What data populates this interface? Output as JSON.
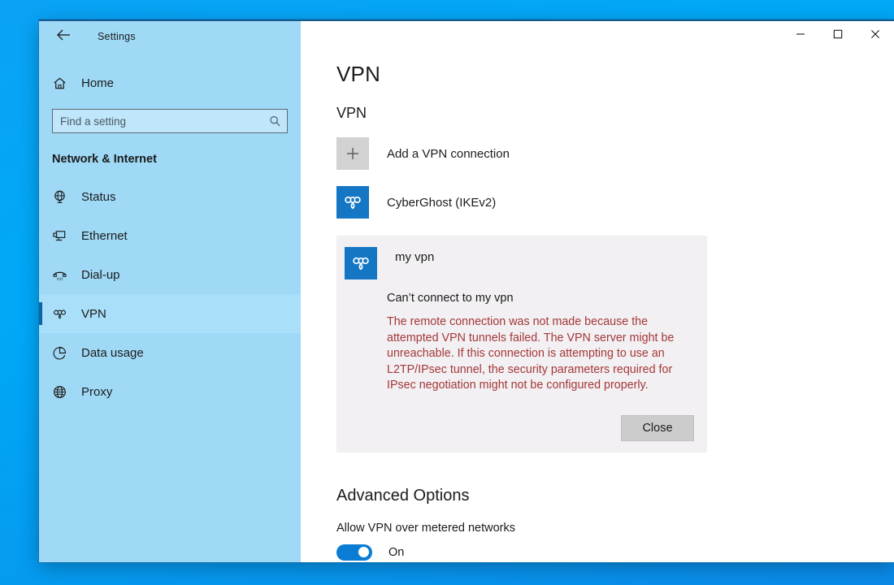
{
  "window": {
    "title": "Settings",
    "back_icon": "back-arrow-icon",
    "controls": {
      "minimize": "minimize-icon",
      "maximize": "maximize-icon",
      "close": "close-icon"
    },
    "accent_color": "#16588f"
  },
  "sidebar": {
    "background_color": "#9fd9f6",
    "home": {
      "label": "Home",
      "icon": "home-icon"
    },
    "search": {
      "placeholder": "Find a setting",
      "value": "",
      "icon": "search-icon"
    },
    "group_heading": "Network & Internet",
    "items": [
      {
        "label": "Status",
        "icon": "globe-status-icon",
        "selected": false
      },
      {
        "label": "Ethernet",
        "icon": "ethernet-icon",
        "selected": false
      },
      {
        "label": "Dial-up",
        "icon": "dialup-icon",
        "selected": false
      },
      {
        "label": "VPN",
        "icon": "vpn-knot-icon",
        "selected": true
      },
      {
        "label": "Data usage",
        "icon": "pie-chart-icon",
        "selected": false
      },
      {
        "label": "Proxy",
        "icon": "globe-icon",
        "selected": false
      }
    ],
    "selected_accent_color": "#1164a8"
  },
  "main": {
    "page_title": "VPN",
    "section_title": "VPN",
    "add_connection": {
      "label": "Add a VPN connection",
      "icon": "plus-icon",
      "tile_color": "#d2d2d2"
    },
    "connections": [
      {
        "name": "CyberGhost (IKEv2)",
        "icon": "vpn-knot-icon",
        "tile_color": "#1577c4"
      }
    ],
    "error_card": {
      "name": "my vpn",
      "icon": "vpn-knot-icon",
      "tile_color": "#1577c4",
      "subtitle": "Can’t connect to my vpn",
      "message": "The remote connection was not made because the attempted VPN tunnels failed. The VPN server might be unreachable. If this connection is attempting to use an L2TP/IPsec tunnel, the security parameters required for IPsec negotiation might not be configured properly.",
      "message_color": "#a4373a",
      "background_color": "#f2f0f2",
      "close_label": "Close"
    },
    "advanced": {
      "title": "Advanced Options",
      "metered_label": "Allow VPN over metered networks",
      "metered_state": "On",
      "metered_on": true,
      "toggle_color": "#0a7cd4"
    }
  }
}
